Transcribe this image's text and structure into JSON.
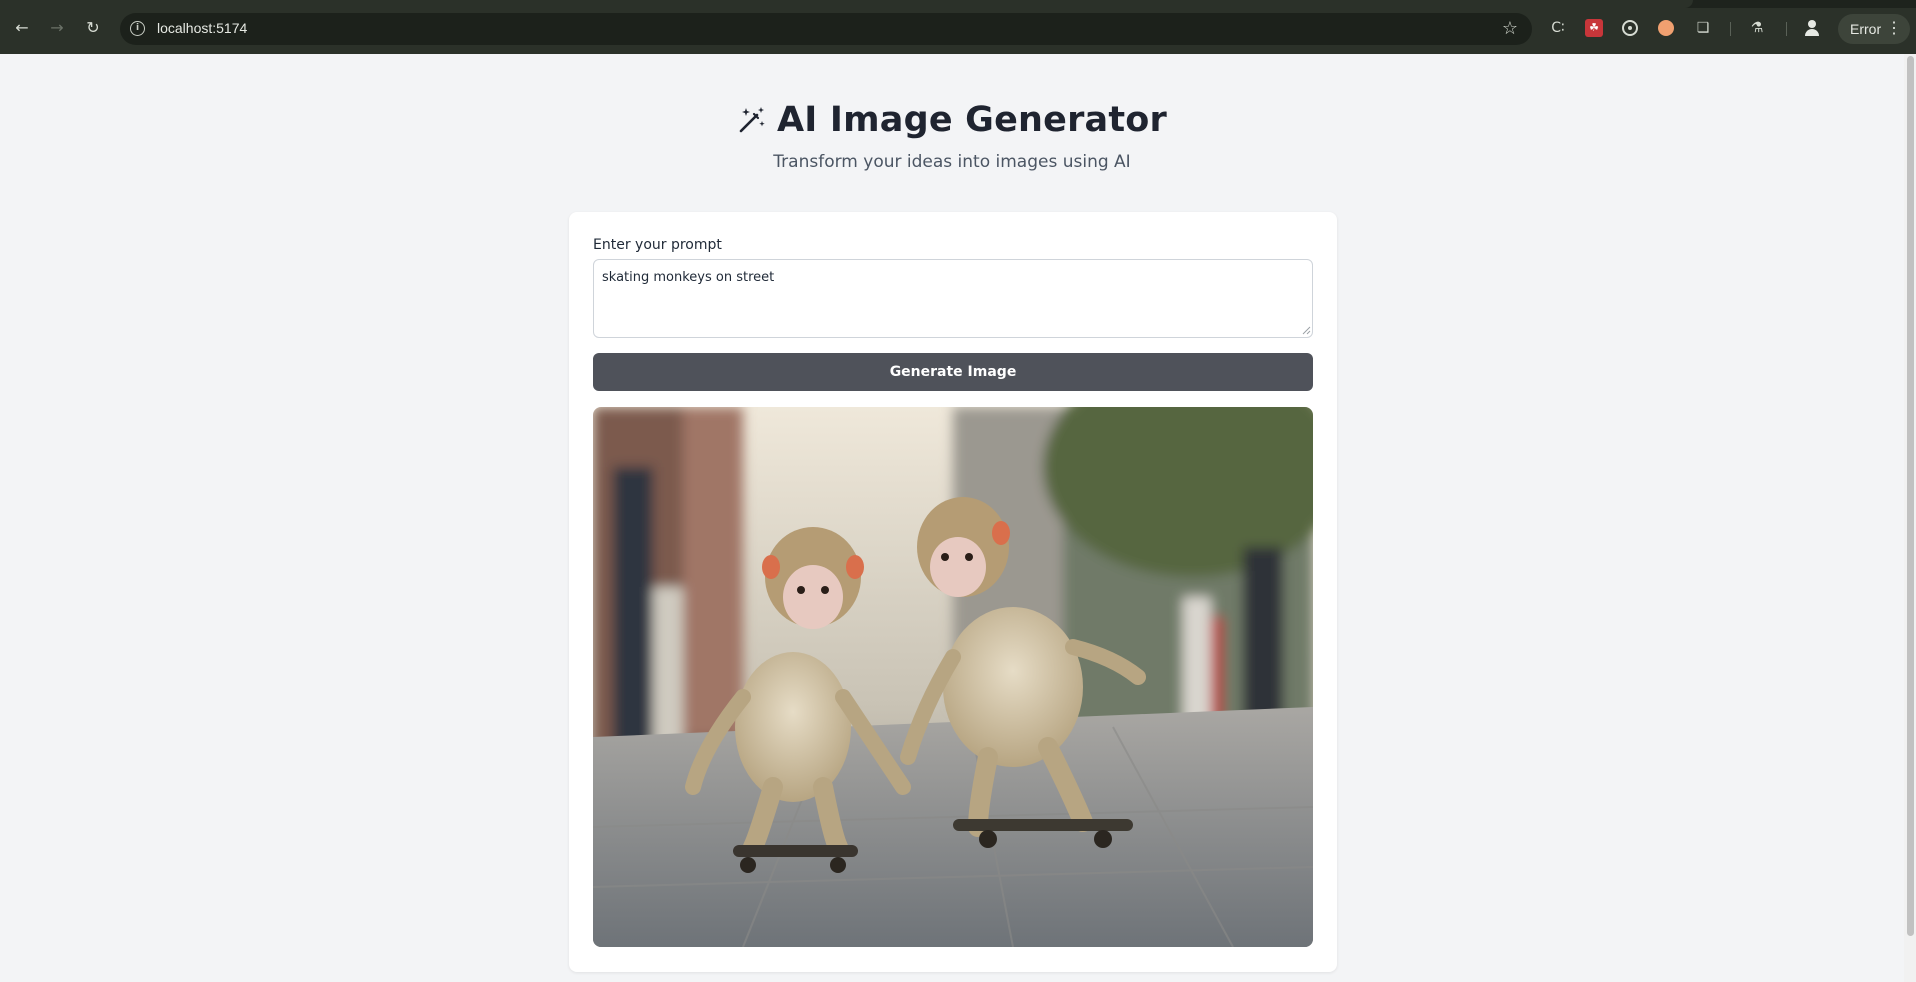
{
  "browser": {
    "url": "localhost:5174",
    "profile_status": "Error"
  },
  "header": {
    "title": "AI Image Generator",
    "subtitle": "Transform your ideas into images using AI"
  },
  "form": {
    "prompt_label": "Enter your prompt",
    "prompt_value": "skating monkeys on street",
    "generate_label": "Generate Image"
  },
  "colors": {
    "button_bg": "#4f525a",
    "page_bg": "#f3f4f6",
    "card_bg": "#ffffff",
    "title": "#1f2430"
  },
  "icons": [
    "back-icon",
    "forward-icon",
    "reload-icon",
    "site-info-icon",
    "bookmark-star-icon",
    "extensions-icon",
    "lab-icon",
    "profile-icon",
    "kebab-menu-icon",
    "magic-wand-icon"
  ]
}
